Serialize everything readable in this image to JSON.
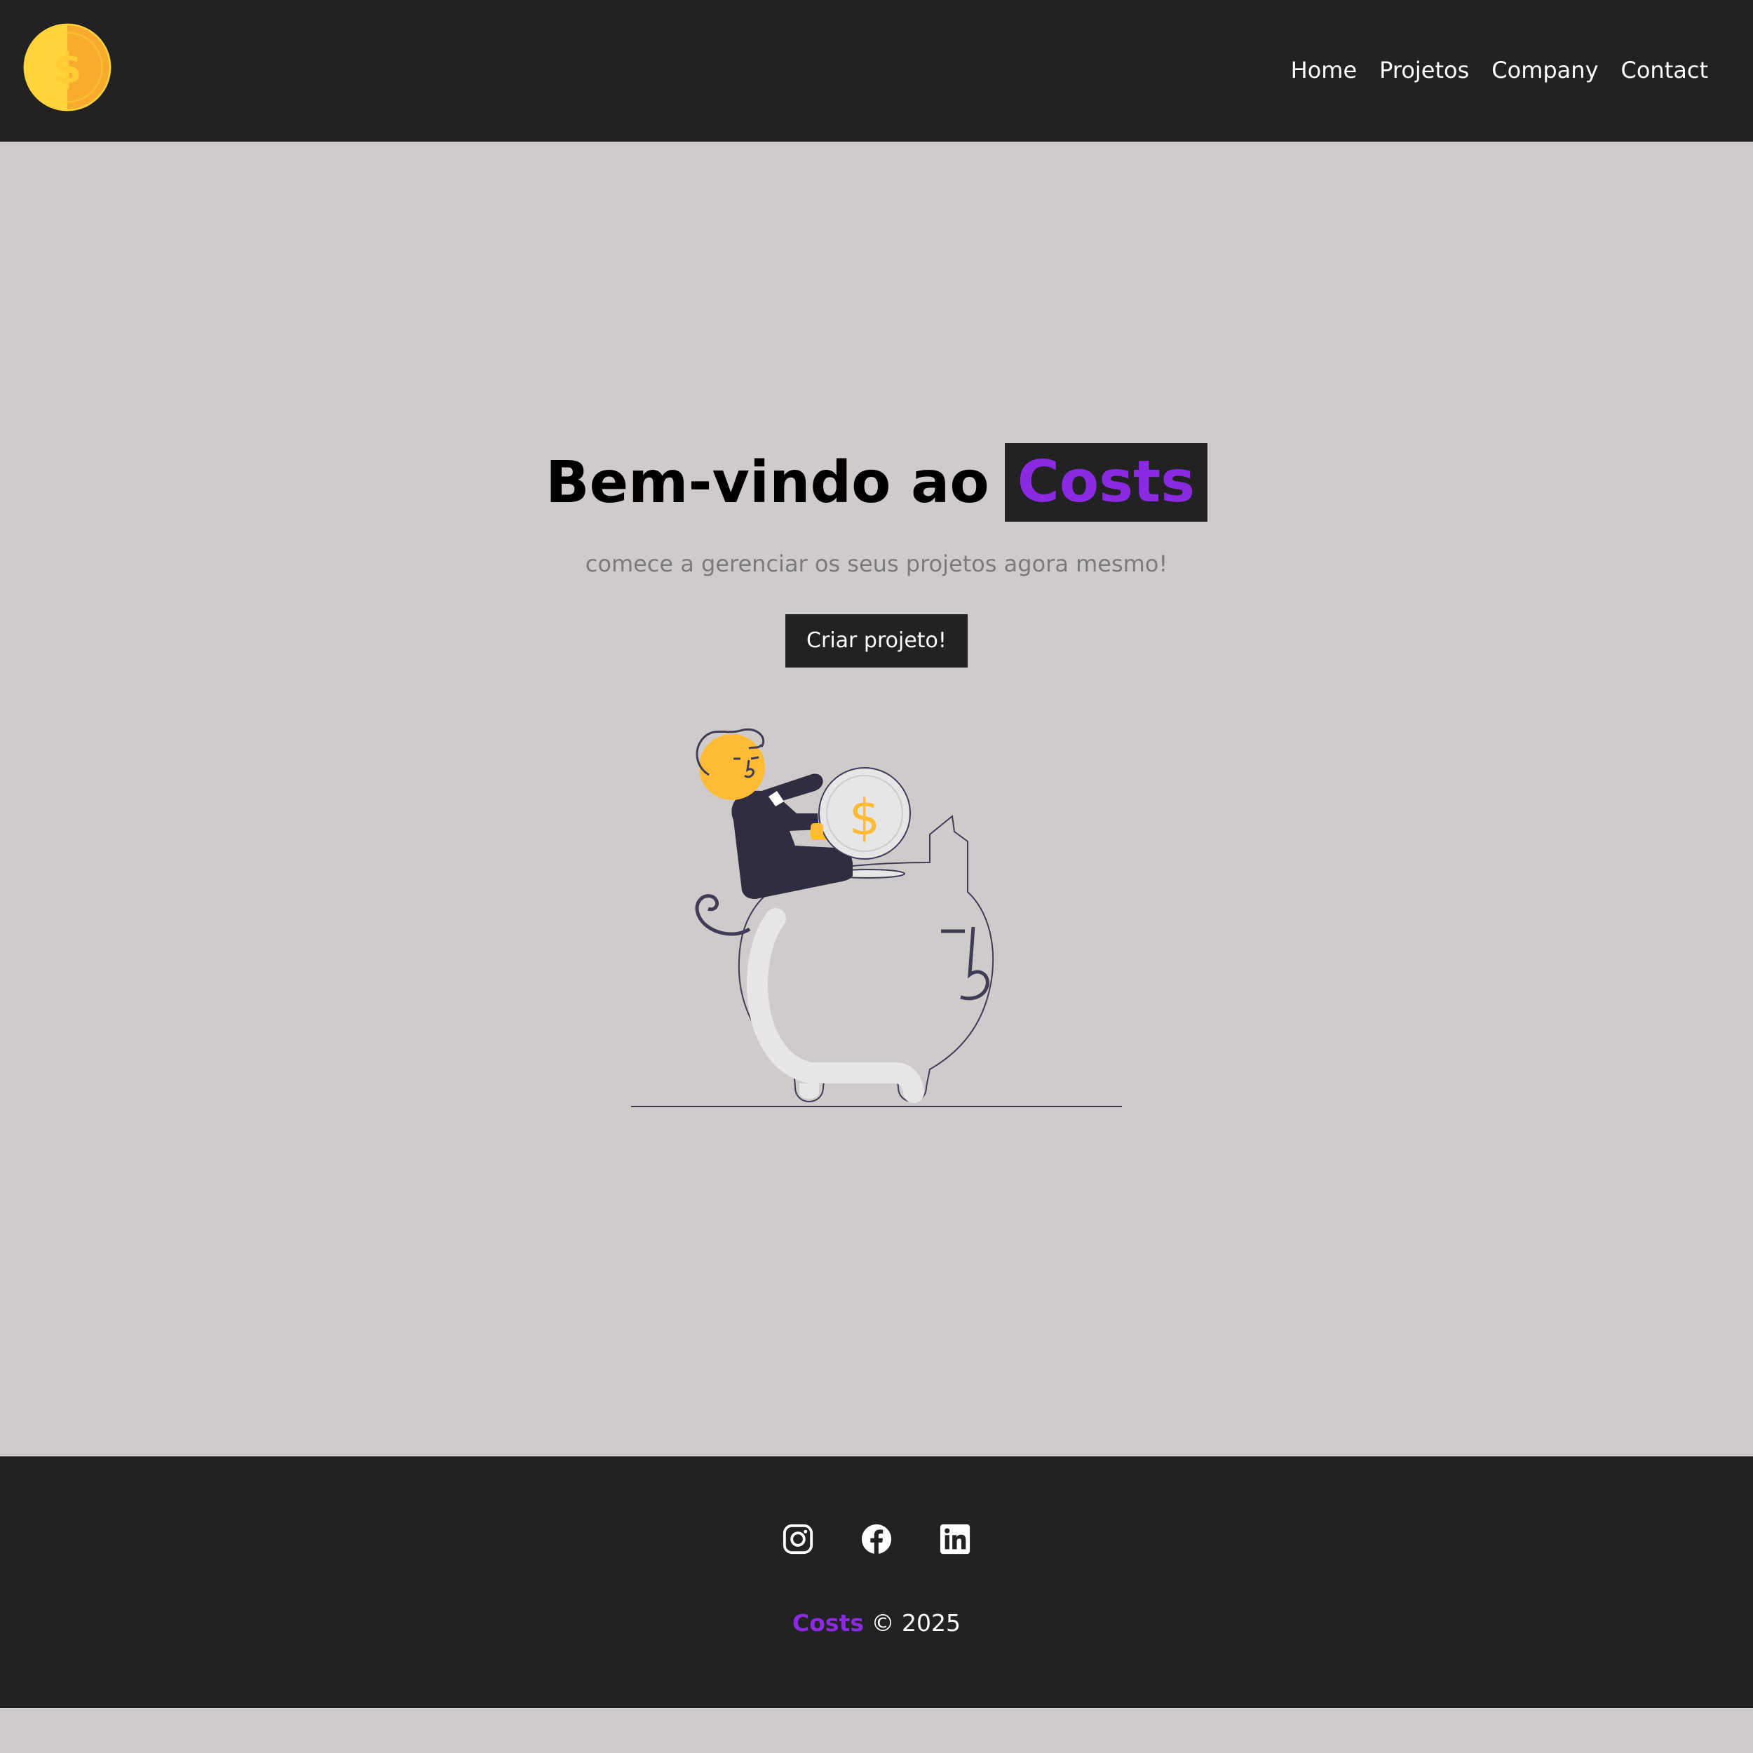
{
  "navbar": {
    "logo_icon": "dollar-coin-icon",
    "links": [
      "Home",
      "Projetos",
      "Company",
      "Contact"
    ]
  },
  "hero": {
    "title_prefix": "Bem-vindo ao",
    "title_brand": "Costs",
    "subtitle": "comece a gerenciar os seus projetos agora mesmo!",
    "cta_label": "Criar projeto!",
    "illustration_icon": "piggy-bank-illustration"
  },
  "footer": {
    "social_icons": [
      "instagram-icon",
      "facebook-icon",
      "linkedin-icon"
    ],
    "brand": "Costs",
    "copyright": "© 2025"
  },
  "colors": {
    "background": "#cfcbca",
    "dark": "#222222",
    "brand_purple": "#8a2be2",
    "coin_yellow": "#ffbb33"
  }
}
